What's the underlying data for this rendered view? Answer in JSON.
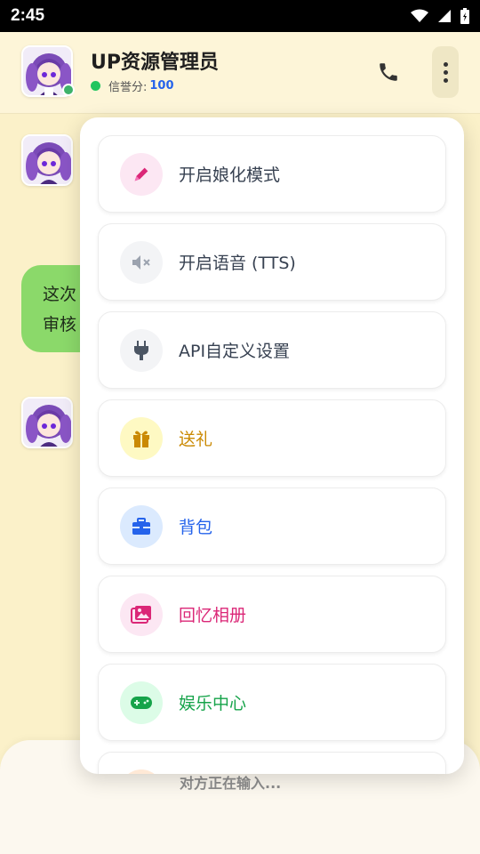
{
  "status_bar": {
    "time": "2:45"
  },
  "header": {
    "title": "UP资源管理员",
    "credit_label": "信誉分:",
    "credit_score": "100"
  },
  "chat": {
    "bubble_line1": "这次",
    "bubble_line2": "审核"
  },
  "menu": {
    "items": [
      {
        "label": "开启娘化模式",
        "icon": "pen-icon",
        "color": "#db2777",
        "icon_bg": "#fce7f3",
        "label_color": "#374151"
      },
      {
        "label": "开启语音 (TTS)",
        "icon": "volume-mute-icon",
        "color": "#9ca3af",
        "icon_bg": "#f3f4f6",
        "label_color": "#374151"
      },
      {
        "label": "API自定义设置",
        "icon": "plug-icon",
        "color": "#4b5563",
        "icon_bg": "#f3f4f6",
        "label_color": "#374151"
      },
      {
        "label": "送礼",
        "icon": "gift-icon",
        "color": "#ca8a04",
        "icon_bg": "#fef9c3",
        "label_color": "#ca8a04"
      },
      {
        "label": "背包",
        "icon": "briefcase-icon",
        "color": "#2563eb",
        "icon_bg": "#dbeafe",
        "label_color": "#2563eb"
      },
      {
        "label": "回忆相册",
        "icon": "photo-album-icon",
        "color": "#db2777",
        "icon_bg": "#fce7f3",
        "label_color": "#db2777"
      },
      {
        "label": "娱乐中心",
        "icon": "gamepad-icon",
        "color": "#16a34a",
        "icon_bg": "#dcfce7",
        "label_color": "#16a34a"
      }
    ]
  },
  "footer": {
    "typing_text": "对方正在输入..."
  }
}
